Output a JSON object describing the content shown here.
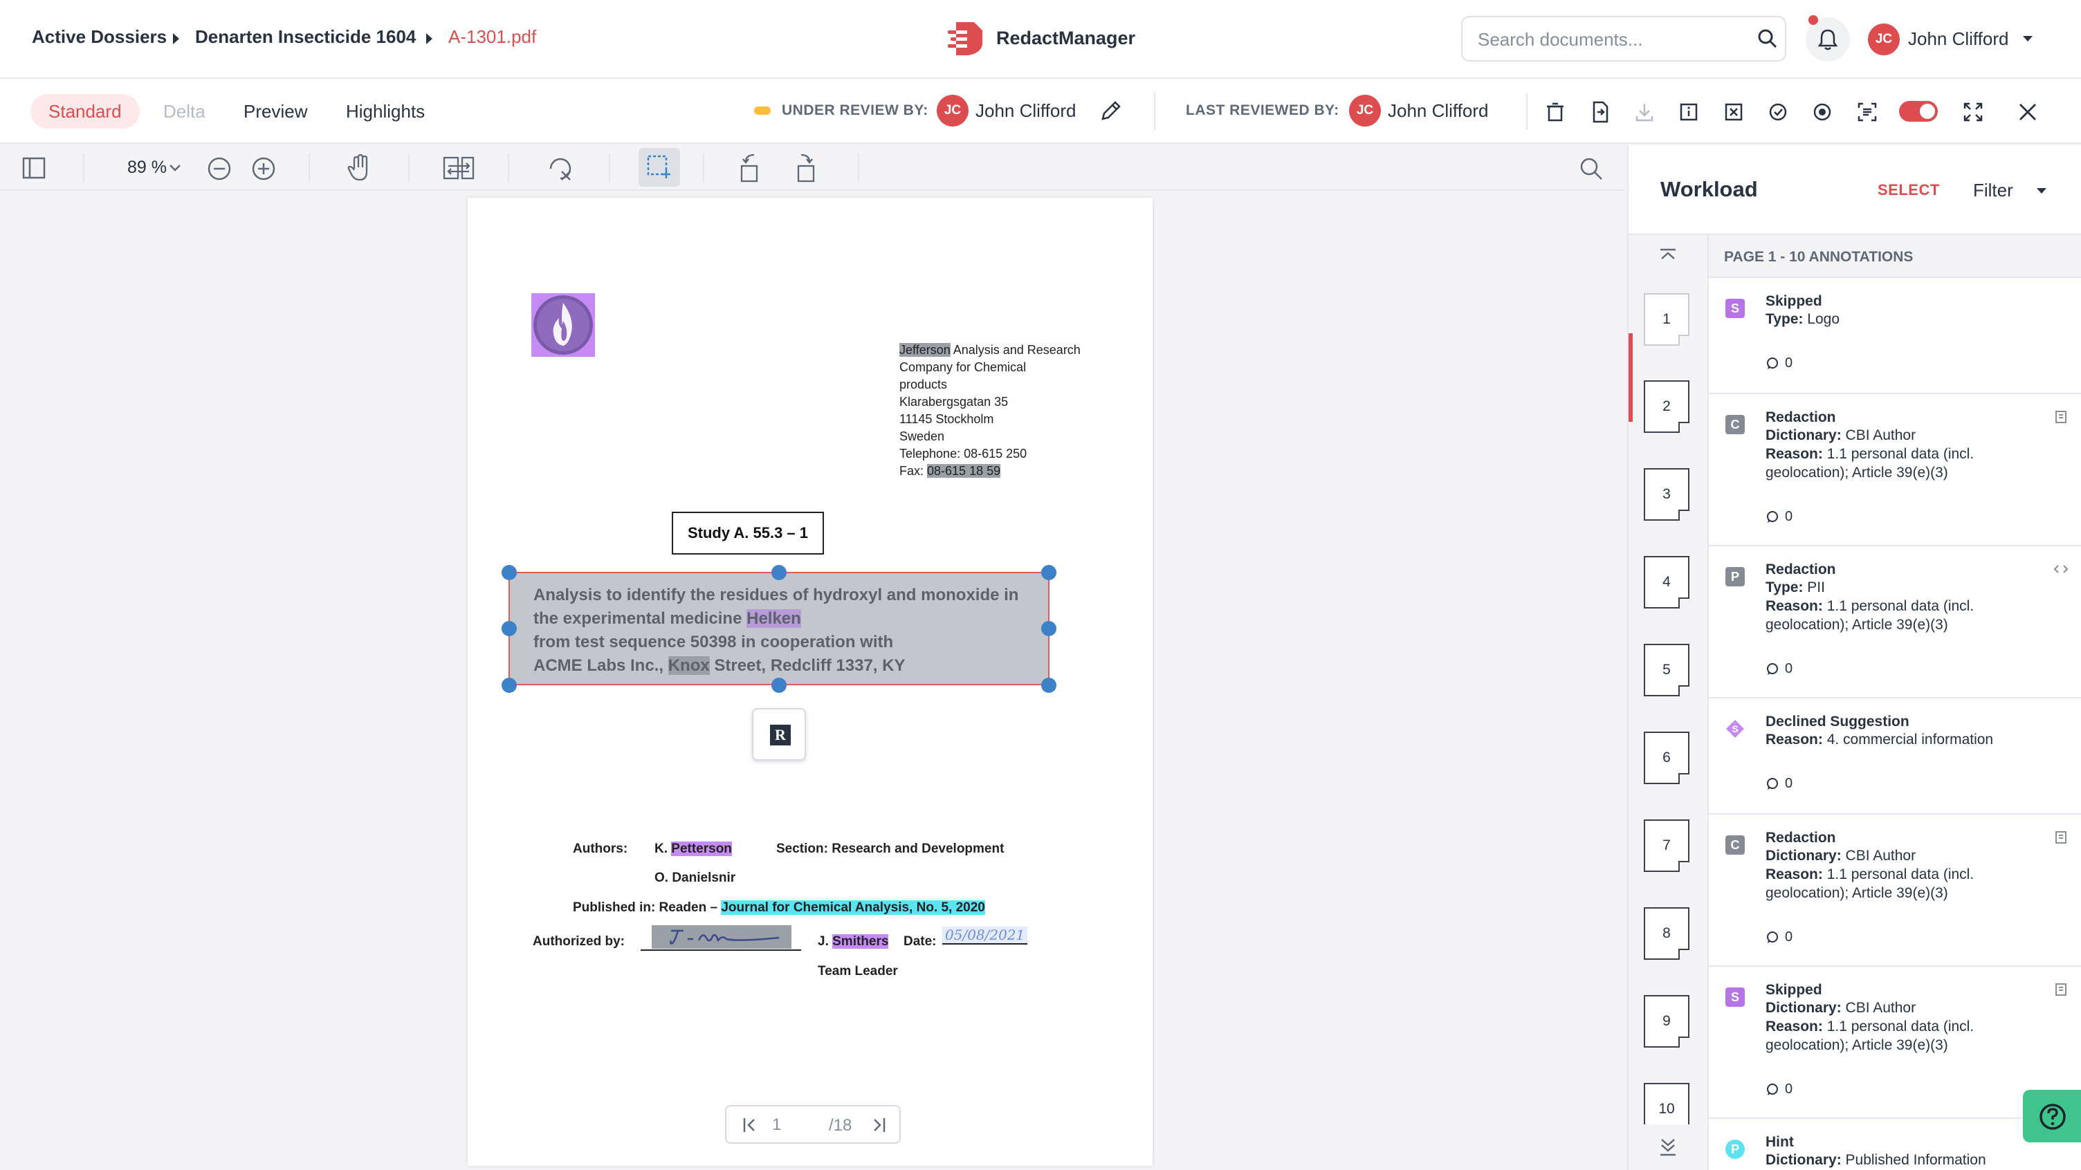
{
  "breadcrumb": {
    "items": [
      "Active Dossiers",
      "Denarten Insecticide 1604"
    ],
    "current": "A-1301.pdf"
  },
  "app": {
    "name": "RedactManager",
    "accent": "#dd4d50"
  },
  "search": {
    "placeholder": "Search documents..."
  },
  "user": {
    "initials": "JC",
    "name": "John Clifford"
  },
  "modes": [
    "Standard",
    "Delta",
    "Preview",
    "Highlights"
  ],
  "review": {
    "under_label": "UNDER REVIEW BY:",
    "under_initials": "JC",
    "under_name": "John Clifford",
    "last_label": "LAST REVIEWED BY:",
    "last_initials": "JC",
    "last_name": "John Clifford"
  },
  "viewer": {
    "zoom": "89 %"
  },
  "document": {
    "address_first": "Jefferson",
    "address_first_rest": " Analysis and Research",
    "address_lines": [
      "Company for Chemical",
      "products",
      "Klarabergsgatan 35",
      "11145 Stockholm",
      "Sweden",
      "Telephone: 08-615 250"
    ],
    "fax_label": "Fax: ",
    "fax_value": "08-615 18 59",
    "study_title": "Study A. 55.3 – 1",
    "title_line1": "Analysis to identify the residues of hydroxyl and monoxide in",
    "title_line2_pre": "the experimental medicine ",
    "title_line2_hl": "Helken",
    "title_line3": "from test sequence 50398 in cooperation with",
    "title_line4_pre": "ACME Labs Inc., ",
    "title_line4_hl": "Knox",
    "title_line4_post": " Street, Redcliff 1337, KY",
    "redact_button": "R",
    "authors_label": "Authors:",
    "author1_pre": "K. ",
    "author1_hl": "Petterson",
    "author2": "O. Danielsnir",
    "section": "Section: Research and Development",
    "published_pre": "Published in: Readen – ",
    "published_hl": "Journal for Chemical Analysis, No. 5, 2020",
    "authorized_label": "Authorized by:",
    "signer_pre": "J. ",
    "signer_hl": "Smithers",
    "date_label": "Date:",
    "date_value": "05/08/2021",
    "team_leader": "Team Leader",
    "page_current": "1",
    "page_total": "/18"
  },
  "workload": {
    "title": "Workload",
    "select": "SELECT",
    "filter": "Filter",
    "header": "PAGE 1 - 10 ANNOTATIONS",
    "thumbs": [
      "1",
      "2",
      "3",
      "4",
      "5",
      "6",
      "7",
      "8",
      "9",
      "10"
    ],
    "annotations": [
      {
        "badge": "S",
        "title": "Skipped",
        "k1": "Type:",
        "v1": "Logo",
        "comments": "0"
      },
      {
        "badge": "C",
        "title": "Redaction",
        "k1": "Dictionary:",
        "v1": "CBI Author",
        "k2": "Reason:",
        "v2": "1.1 personal data (incl.",
        "v3": "geolocation); Article 39(e)(3)",
        "comments": "0"
      },
      {
        "badge": "P",
        "title": "Redaction",
        "k1": "Type:",
        "v1": "PII",
        "k2": "Reason:",
        "v2": "1.1 personal data (incl.",
        "v3": "geolocation); Article 39(e)(3)",
        "comments": "0"
      },
      {
        "badge": "S",
        "title": "Declined Suggestion",
        "k1": "Reason:",
        "v1": "4. commercial information",
        "comments": "0"
      },
      {
        "badge": "C",
        "title": "Redaction",
        "k1": "Dictionary:",
        "v1": "CBI Author",
        "k2": "Reason:",
        "v2": "1.1 personal data (incl.",
        "v3": "geolocation); Article 39(e)(3)",
        "comments": "0"
      },
      {
        "badge": "S",
        "title": "Skipped",
        "k1": "Dictionary:",
        "v1": "CBI Author",
        "k2": "Reason:",
        "v2": "1.1 personal data (incl.",
        "v3": "geolocation); Article 39(e)(3)",
        "comments": "0"
      },
      {
        "badge": "P",
        "title": "Hint",
        "k1": "Dictionary:",
        "v1": "Published Information"
      }
    ]
  },
  "icons": {
    "bell": "bell-icon",
    "search": "search-icon",
    "edit": "pencil-icon",
    "help": "help-icon",
    "close": "close-icon"
  }
}
